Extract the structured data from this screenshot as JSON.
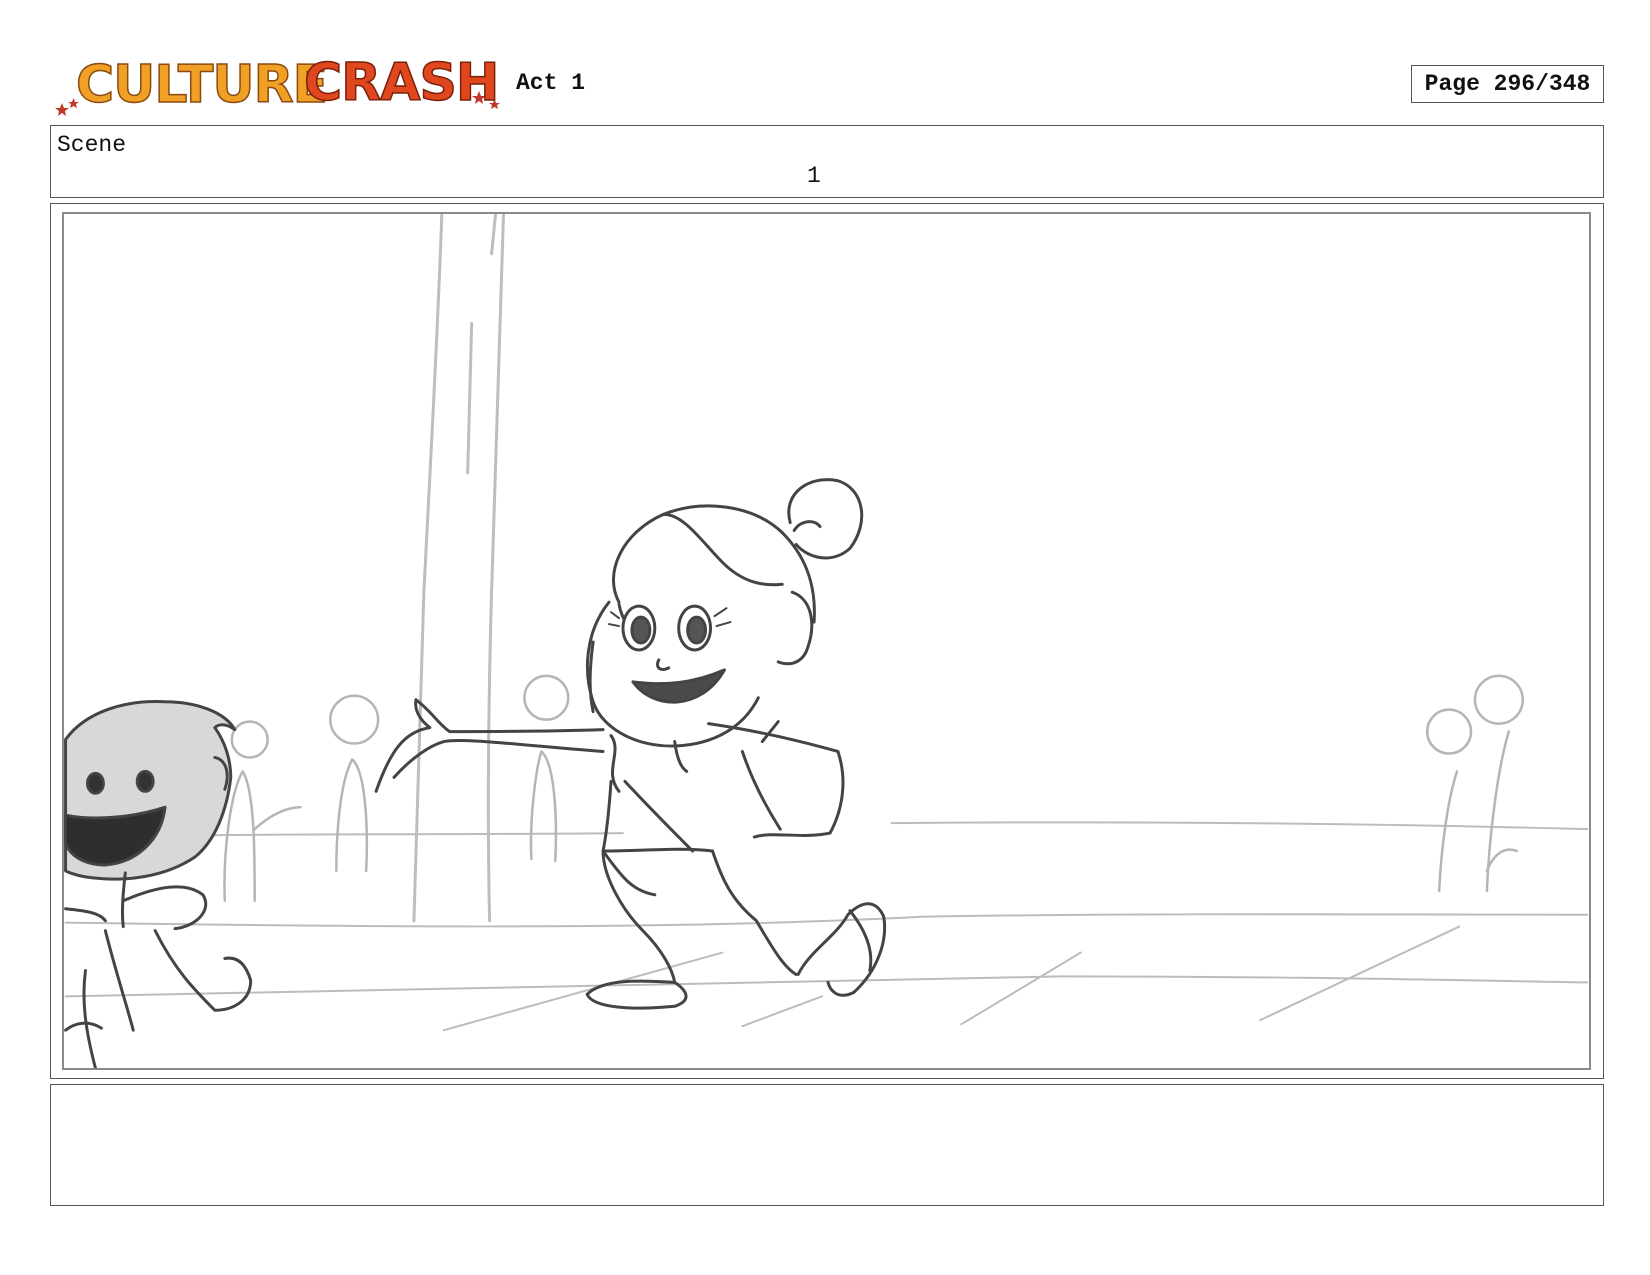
{
  "header": {
    "logo_text": "CULTURE CRASH",
    "act_label": "Act 1",
    "page_label": "Page 296/348"
  },
  "scene": {
    "label": "Scene",
    "number": "1"
  },
  "panel": {
    "line_color": "#444444",
    "background_line_color": "#b8b8b8"
  },
  "notes": {
    "text": ""
  },
  "colors": {
    "logo_orange": "#f0a024",
    "logo_red": "#e0471e",
    "border": "#555555"
  }
}
